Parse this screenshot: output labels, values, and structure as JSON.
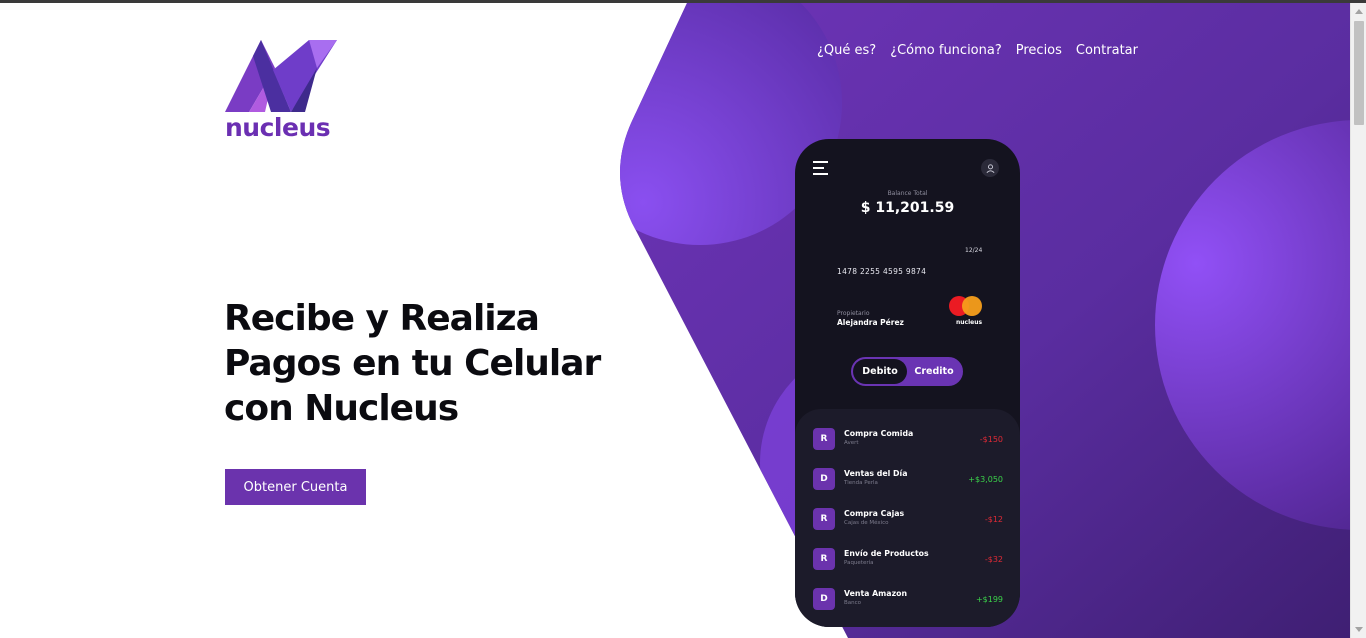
{
  "brand": {
    "name": "nucleus",
    "color": "#6b2fb2"
  },
  "nav": {
    "items": [
      "¿Qué es?",
      "¿Cómo funciona?",
      "Precios",
      "Contratar"
    ]
  },
  "hero": {
    "title_line1": "Recibe y Realiza",
    "title_line2": "Pagos en tu Celular",
    "title_line3": "con Nucleus",
    "cta_label": "Obtener Cuenta",
    "accent": "#6b33ad"
  },
  "phone": {
    "balance_label": "Balance Total",
    "balance": "$ 11,201.59",
    "card_expiry": "12/24",
    "card_number": "1478 2255 4595 9874",
    "owner_label": "Propietario",
    "owner_name": "Alejandra Pérez",
    "card_brand": "nucleus",
    "toggle": {
      "debit": "Debito",
      "credit": "Credito"
    },
    "transactions": [
      {
        "badge": "R",
        "name": "Compra Comida",
        "sub": "Avert",
        "amount": "-$150",
        "sign": "neg"
      },
      {
        "badge": "D",
        "name": "Ventas del Día",
        "sub": "Tienda Perla",
        "amount": "+$3,050",
        "sign": "pos"
      },
      {
        "badge": "R",
        "name": "Compra Cajas",
        "sub": "Cajas de México",
        "amount": "-$12",
        "sign": "neg"
      },
      {
        "badge": "R",
        "name": "Envío de Productos",
        "sub": "Paquetería",
        "amount": "-$32",
        "sign": "neg"
      },
      {
        "badge": "D",
        "name": "Venta Amazon",
        "sub": "Banco",
        "amount": "+$199",
        "sign": "pos"
      }
    ]
  },
  "icons": {
    "menu": "hamburger-menu-icon",
    "user": "user-icon",
    "card_logo": "mastercard-icon"
  }
}
